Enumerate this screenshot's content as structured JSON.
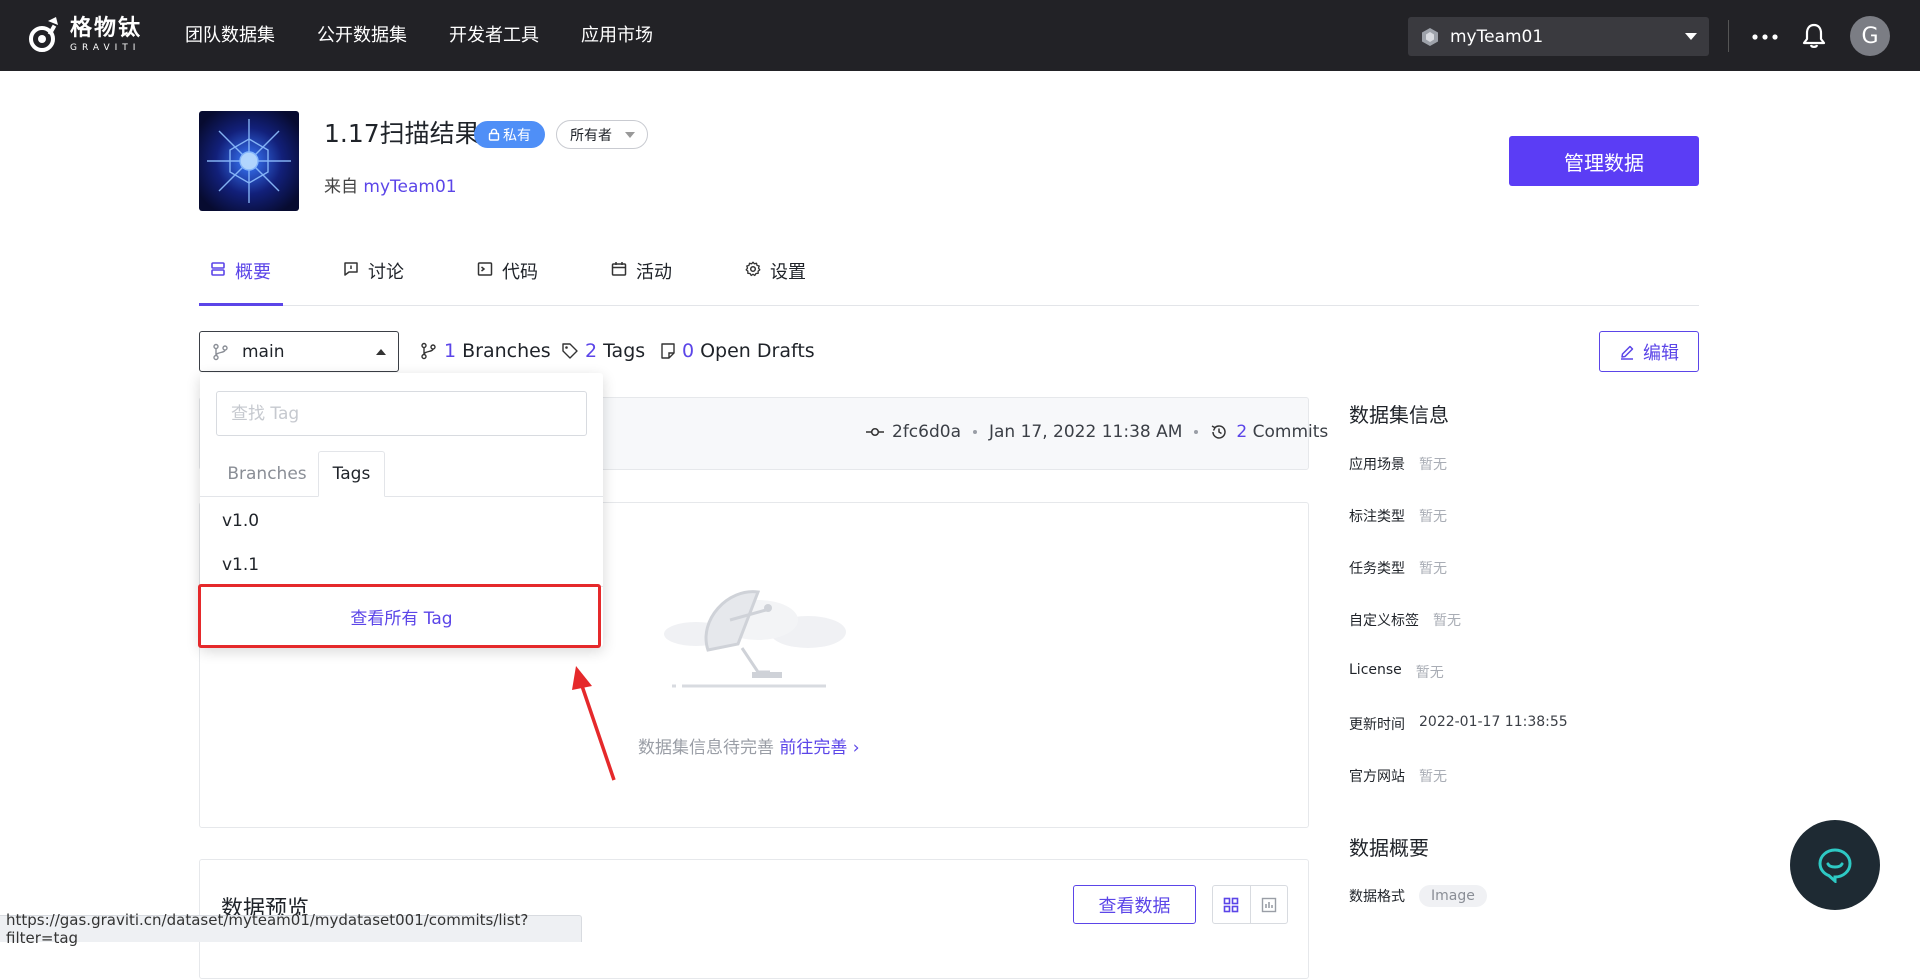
{
  "brand": {
    "name_cn": "格物钛",
    "name_en": "GRAVITI"
  },
  "nav": [
    "团队数据集",
    "公开数据集",
    "开发者工具",
    "应用市场"
  ],
  "team_select": {
    "value": "myTeam01"
  },
  "user": {
    "avatar_letter": "G"
  },
  "dataset": {
    "title": "1.17扫描结果",
    "privacy_badge": "私有",
    "owner_filter": "所有者",
    "from_label": "来自",
    "from_team": "myTeam01",
    "manage_button": "管理数据"
  },
  "tabs": [
    {
      "label": "概要",
      "icon": "overview-icon",
      "active": true
    },
    {
      "label": "讨论",
      "icon": "discussion-icon",
      "active": false
    },
    {
      "label": "代码",
      "icon": "code-icon",
      "active": false
    },
    {
      "label": "活动",
      "icon": "calendar-icon",
      "active": false
    },
    {
      "label": "设置",
      "icon": "gear-icon",
      "active": false
    }
  ],
  "branch": {
    "current": "main",
    "branches_count": "1",
    "branches_label": "Branches",
    "tags_count": "2",
    "tags_label": "Tags",
    "drafts_count": "0",
    "drafts_label": "Open Drafts"
  },
  "edit_button": "编辑",
  "commit": {
    "hash": "2fc6d0a",
    "date": "Jan 17, 2022 11:38 AM",
    "commits_count": "2",
    "commits_label": "Commits"
  },
  "empty_state": {
    "text": "数据集信息待完善",
    "link": "前往完善"
  },
  "preview": {
    "title": "数据预览",
    "view_button": "查看数据"
  },
  "dropdown": {
    "search_placeholder": "查找 Tag",
    "tab_branches": "Branches",
    "tab_tags": "Tags",
    "items": [
      "v1.0",
      "v1.1"
    ],
    "view_all": "查看所有 Tag"
  },
  "sidebar": {
    "info_title": "数据集信息",
    "rows": [
      {
        "key": "应用场景",
        "value": "暂无"
      },
      {
        "key": "标注类型",
        "value": "暂无"
      },
      {
        "key": "任务类型",
        "value": "暂无"
      },
      {
        "key": "自定义标签",
        "value": "暂无"
      },
      {
        "key": "License",
        "value": "暂无"
      },
      {
        "key": "更新时间",
        "value": "2022-01-17 11:38:55"
      },
      {
        "key": "官方网站",
        "value": "暂无"
      }
    ],
    "overview_title": "数据概要",
    "format_key": "数据格式",
    "format_value": "Image"
  },
  "status_bar_url": "https://gas.graviti.cn/dataset/myteam01/mydataset001/commits/list?filter=tag",
  "colors": {
    "accent": "#5b45e8",
    "button_primary": "#5b3df5",
    "topbar": "#222226",
    "highlight": "#e5292b"
  }
}
